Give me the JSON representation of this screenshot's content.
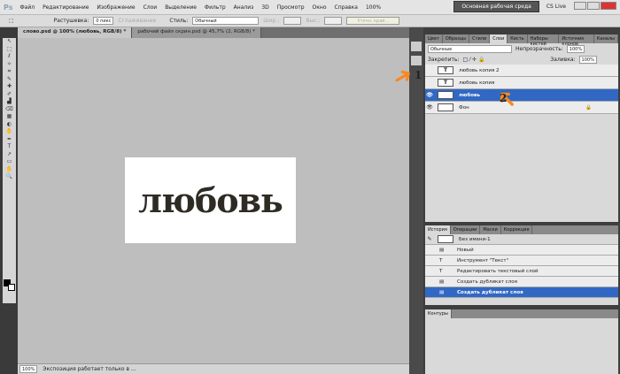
{
  "app": {
    "logo": "Ps",
    "menu": [
      "Файл",
      "Редактирование",
      "Изображение",
      "Слои",
      "Выделение",
      "Фильтр",
      "Анализ",
      "3D",
      "Просмотр",
      "Окно",
      "Справка"
    ],
    "zoom": "100%",
    "workspace": "Основная рабочая среда",
    "cs_live": "CS Live"
  },
  "options": {
    "feather_label": "Растушевка:",
    "feather_value": "0 пикс",
    "antialias": "Сглаживание",
    "style_label": "Стиль:",
    "style_value": "Обычный",
    "width_label": "Шир.:",
    "height_label": "Выс.:",
    "refine": "Уточн. край..."
  },
  "tabs": [
    {
      "label": "слово.psd @ 100% (любовь, RGB/8) *"
    },
    {
      "label": "рабочий файл скрин.psd @ 45,7% (2, RGB/8) *"
    }
  ],
  "document": {
    "text": "любовь"
  },
  "status": {
    "zoom": "100%",
    "message": "Экспозиция работает только в ..."
  },
  "layers_panel": {
    "tabs": [
      "Цвет",
      "Образцы",
      "Стили",
      "Слои",
      "Кисть",
      "Наборы кистей",
      "Источник клонов",
      "Каналы"
    ],
    "active_tab": "Слои",
    "blend": "Обычные",
    "opacity_label": "Непрозрачность:",
    "opacity": "100%",
    "lock_label": "Закрепить:",
    "fill_label": "Заливка:",
    "fill": "100%",
    "layers": [
      {
        "name": "любовь копия 2",
        "type": "T"
      },
      {
        "name": "любовь копия",
        "type": "T"
      },
      {
        "name": "любовь",
        "type": "T",
        "selected": true
      },
      {
        "name": "Фон",
        "type": ""
      }
    ]
  },
  "history_panel": {
    "tabs": [
      "История",
      "Операции",
      "Маски",
      "Коррекция"
    ],
    "snapshot": "Без имени-1",
    "items": [
      "Новый",
      "Инструмент \"Текст\"",
      "Редактировать текстовый слой",
      "Создать дубликат слоя",
      "Создать дубликат слоя"
    ]
  },
  "paths_panel": {
    "tab": "Контуры"
  },
  "annotations": {
    "arrow1": "1",
    "arrow2": "2",
    "color": "#f7891f"
  }
}
